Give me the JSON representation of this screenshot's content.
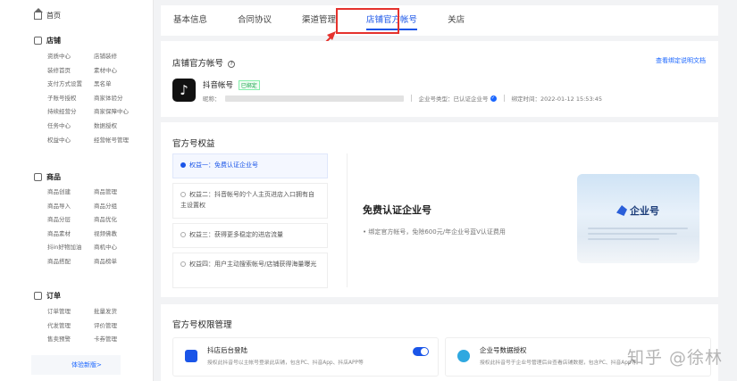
{
  "sidebar": {
    "home": "首页",
    "sections": [
      {
        "title": "店铺",
        "items": [
          "资质中心",
          "店铺装修",
          "装修首页",
          "素材中心",
          "支付方式设置",
          "黑名单",
          "子账号授权",
          "商家体验分",
          "持续经营分",
          "商家保障中心",
          "任务中心",
          "数据授权",
          "权益中心",
          "经营帐号管理"
        ]
      },
      {
        "title": "商品",
        "items": [
          "商品创建",
          "商品管理",
          "商品导入",
          "商品分组",
          "商品分层",
          "商品优化",
          "商品素材",
          "视频佛教",
          "抖in好物加油",
          "商机中心",
          "商品搭配",
          "商品榜单"
        ]
      },
      {
        "title": "订单",
        "items": [
          "订单管理",
          "批量发货",
          "代发管理",
          "评价管理",
          "售卖预警",
          "卡券管理"
        ]
      }
    ],
    "trial_link": "体验新版>"
  },
  "tabs": [
    "基本信息",
    "合同协议",
    "渠道管理",
    "店铺官方帐号",
    "关店"
  ],
  "active_tab": 3,
  "account": {
    "title": "店铺官方帐号",
    "help_link": "查看绑定说明文档",
    "name": "抖音帐号",
    "badge": "已绑定",
    "nickname_label": "昵称：",
    "type_label": "企业号类型：已认证企业号",
    "bind_time": "绑定时间：2022-01-12 15:53:45"
  },
  "rights": {
    "title": "官方号权益",
    "items": [
      "权益一：免费认证企业号",
      "权益二：抖音帐号的个人主页进店入口拥有自主设置权",
      "权益三：获得更多稳定的进店流量",
      "权益四：用户主动搜索帐号/店铺获得海量曝光"
    ],
    "detail_title": "免费认证企业号",
    "detail_desc": "• 绑定官方帐号，免除600元/年企业号蓝V认证费用",
    "promo_logo": "企业号"
  },
  "permissions": {
    "title": "官方号权限管理",
    "cards": [
      {
        "name": "抖店后台登陆",
        "desc": "授权此抖音号以主帐号登录此店铺，包含PC、抖音App、抖店APP等",
        "enabled": true
      },
      {
        "name": "企业号数据授权",
        "desc": "授权此抖音号于企业号管理后台查看店铺数据，包含PC、抖音App等",
        "enabled": true
      }
    ]
  },
  "watermark": "知乎 @徐林",
  "colors": {
    "accent": "#1a55e8",
    "highlight": "#e5322d"
  }
}
